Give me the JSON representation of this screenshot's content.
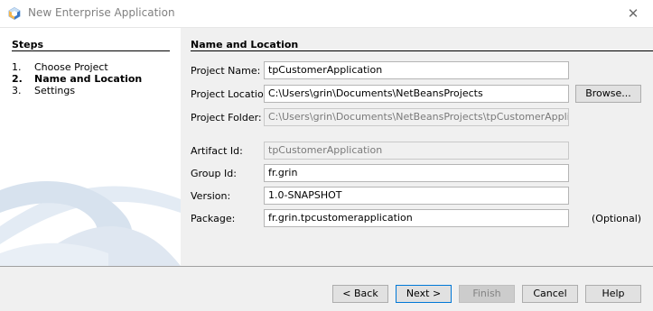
{
  "window": {
    "title": "New Enterprise Application",
    "icon": "netbeans-icon",
    "close_glyph": "✕"
  },
  "steps": {
    "title": "Steps",
    "items": [
      {
        "num": "1.",
        "label": "Choose Project",
        "active": false
      },
      {
        "num": "2.",
        "label": "Name and Location",
        "active": true
      },
      {
        "num": "3.",
        "label": "Settings",
        "active": false
      }
    ]
  },
  "section": {
    "title": "Name and Location"
  },
  "form": {
    "project_name": {
      "label": "Project Name:",
      "value": "tpCustomerApplication"
    },
    "project_location": {
      "label": "Project Location:",
      "value": "C:\\Users\\grin\\Documents\\NetBeansProjects"
    },
    "project_folder": {
      "label": "Project Folder:",
      "value": "C:\\Users\\grin\\Documents\\NetBeansProjects\\tpCustomerApplication"
    },
    "artifact_id": {
      "label": "Artifact Id:",
      "value": "tpCustomerApplication"
    },
    "group_id": {
      "label": "Group Id:",
      "value": "fr.grin"
    },
    "version": {
      "label": "Version:",
      "value": "1.0-SNAPSHOT"
    },
    "package": {
      "label": "Package:",
      "value": "fr.grin.tpcustomerapplication",
      "hint": "(Optional)"
    },
    "browse_label": "Browse..."
  },
  "buttons": {
    "back": "< Back",
    "next": "Next >",
    "finish": "Finish",
    "cancel": "Cancel",
    "help": "Help"
  },
  "colors": {
    "accent": "#0078d7",
    "panel_bg": "#ffffff",
    "dialog_bg": "#f0f0f0"
  }
}
